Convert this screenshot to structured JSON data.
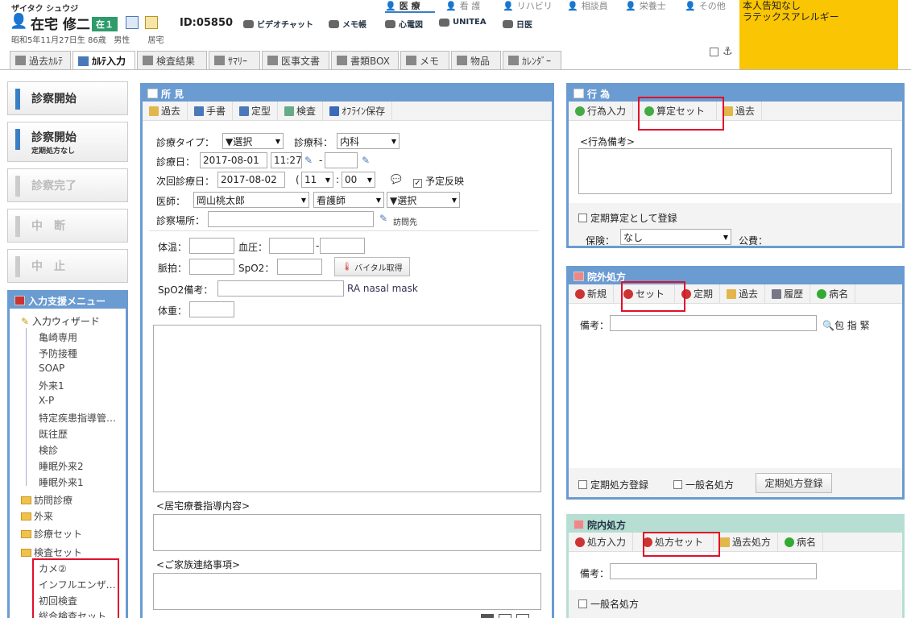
{
  "patient": {
    "kana": "ザイタク シュウジ",
    "name": "在宅 修二",
    "status_badge": "在１",
    "id": "ID:05850",
    "birth": "昭和5年11月27日生 86歳",
    "sex": "男性",
    "category": "居宅"
  },
  "quick_tools": [
    "ビデオチャット",
    "メモ帳",
    "心電図",
    "UNITEA",
    "日医"
  ],
  "top_nav": [
    "医 療",
    "看 護",
    "リハビリ",
    "相談員",
    "栄養士",
    "その他"
  ],
  "alert": [
    "本人告知なし",
    "ラテックスアレルギー"
  ],
  "tabs": [
    "過去ｶﾙﾃ",
    "ｶﾙﾃ入力",
    "検査結果",
    "ｻﾏﾘｰ",
    "医事文書",
    "書類BOX",
    "メモ",
    "物品",
    "ｶﾚﾝﾀﾞｰ"
  ],
  "left_buttons": [
    {
      "label": "診察開始",
      "sub": ""
    },
    {
      "label": "診察開始",
      "sub": "定期処方なし"
    },
    {
      "label": "診察完了",
      "sub": ""
    },
    {
      "label": "中　断",
      "sub": ""
    },
    {
      "label": "中　止",
      "sub": ""
    }
  ],
  "support_menu": {
    "title": "入力支援メニュー",
    "wizard": "入力ウィザード",
    "wizard_items": [
      "亀崎専用",
      "予防接種",
      "SOAP",
      "外来1",
      "X-P",
      "特定疾患指導管…",
      "既往歴",
      "検診",
      "睡眠外来2",
      "睡眠外来1"
    ],
    "folders": [
      "訪問診療",
      "外来",
      "診療セット",
      "検査セット"
    ],
    "exam_items": [
      "カメ②",
      "インフルエンザ…",
      "初回検査",
      "総合検査セット"
    ]
  },
  "findings": {
    "title": "所 見",
    "toolbar": [
      "過去",
      "手書",
      "定型",
      "検査",
      "ｵﾌﾗｲﾝ保存"
    ],
    "type_label": "診療タイプ：",
    "type_value": "▼選択",
    "dept_label": "診療科：",
    "dept_value": "内科",
    "date_label": "診療日：",
    "date_value": "2017-08-01",
    "time_value": "11:27",
    "time_sep": "-",
    "next_label": "次回診療日：",
    "next_value": "2017-08-02",
    "next_paren": "(",
    "next_hour": "11",
    "next_colon": ":",
    "next_min": "00",
    "reflect_label": "予定反映",
    "doctor_label": "医師：",
    "doctor_value": "岡山桃太郎",
    "nurse_value": "看護師",
    "other_value": "▼選択",
    "place_label": "診察場所：",
    "visit_label": "訪問先",
    "temp_label": "体温：",
    "bp_label": "血圧：",
    "bp_sep": "-",
    "pulse_label": "脈拍：",
    "spo2_label": "SpO2：",
    "vital_button": "バイタル取得",
    "spo2note_label": "SpO2備考：",
    "spo2note_text": "RA nasal mask",
    "weight_label": "体重：",
    "home_label": "<居宅療養指導内容>",
    "family_label": "<ご家族連絡事項>"
  },
  "action": {
    "title": "行 為",
    "toolbar": [
      "行為入力",
      "算定セット",
      "過去"
    ],
    "note_label": "<行為備考>",
    "periodic_label": "定期算定として登録",
    "insurance_label": "保険：",
    "insurance_value": "なし",
    "public_label": "公費："
  },
  "outside_rx": {
    "title": "院外処方",
    "toolbar": [
      "新規",
      "セット",
      "定期",
      "過去",
      "履歴",
      "病名"
    ],
    "note_label": "備考：",
    "pack_label": "包 指 緊",
    "periodic_label": "定期処方登録",
    "generic_label": "一般名処方",
    "register_button": "定期処方登録"
  },
  "inside_rx": {
    "title": "院内処方",
    "toolbar": [
      "処方入力",
      "処方セット",
      "過去処方",
      "病名"
    ],
    "note_label": "備考：",
    "generic_label": "一般名処方"
  },
  "colors": {
    "panel": "#6a9bd1",
    "green_panel": "#b6ded2",
    "alert": "#fac502",
    "highlight": "#e0102a"
  }
}
